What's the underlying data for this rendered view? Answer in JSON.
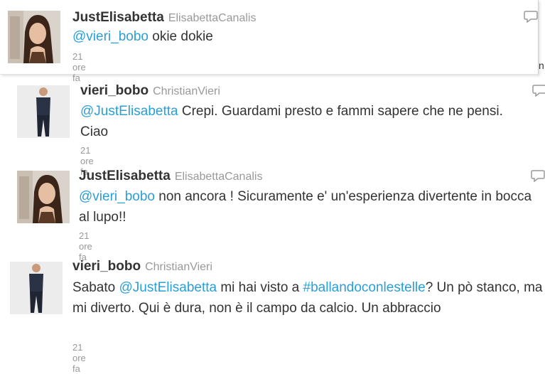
{
  "tweets": [
    {
      "screen_name": "JustElisabetta",
      "full_name": "ElisabettaCanalis",
      "parts": [
        {
          "text": "@vieri_bobo",
          "link": true
        },
        {
          "text": " okie dokie",
          "link": false
        }
      ],
      "time": "21 ore fa",
      "avatar": "woman-photo"
    },
    {
      "screen_name": "vieri_bobo",
      "full_name": "ChristianVieri",
      "parts": [
        {
          "text": "@JustElisabetta",
          "link": true
        },
        {
          "text": " Crepi. Guardami presto e fammi sapere che ne pensi. Ciao",
          "link": false
        }
      ],
      "time": "21 ore fa",
      "avatar": "man-photo"
    },
    {
      "screen_name": "JustElisabetta",
      "full_name": "ElisabettaCanalis",
      "parts": [
        {
          "text": "@vieri_bobo",
          "link": true
        },
        {
          "text": " non ancora ! Sicuramente e' un'esperienza divertente in bocca al lupo!!",
          "link": false
        }
      ],
      "time": "21 ore fa",
      "avatar": "woman-photo"
    },
    {
      "screen_name": "vieri_bobo",
      "full_name": "ChristianVieri",
      "parts": [
        {
          "text": "Sabato ",
          "link": false
        },
        {
          "text": "@JustElisabetta",
          "link": true
        },
        {
          "text": " mi hai visto a ",
          "link": false
        },
        {
          "text": "#ballandoconlestelle",
          "link": true
        },
        {
          "text": "? Un pò stanco, ma mi diverto. Qui è dura, non è il campo da calcio. Un abbraccio",
          "link": false
        }
      ],
      "time": "21 ore fa",
      "avatar": "man-photo"
    }
  ],
  "edge_glyph": "n",
  "colors": {
    "link": "#2a9fd6",
    "text": "#333333",
    "meta": "#999999"
  }
}
